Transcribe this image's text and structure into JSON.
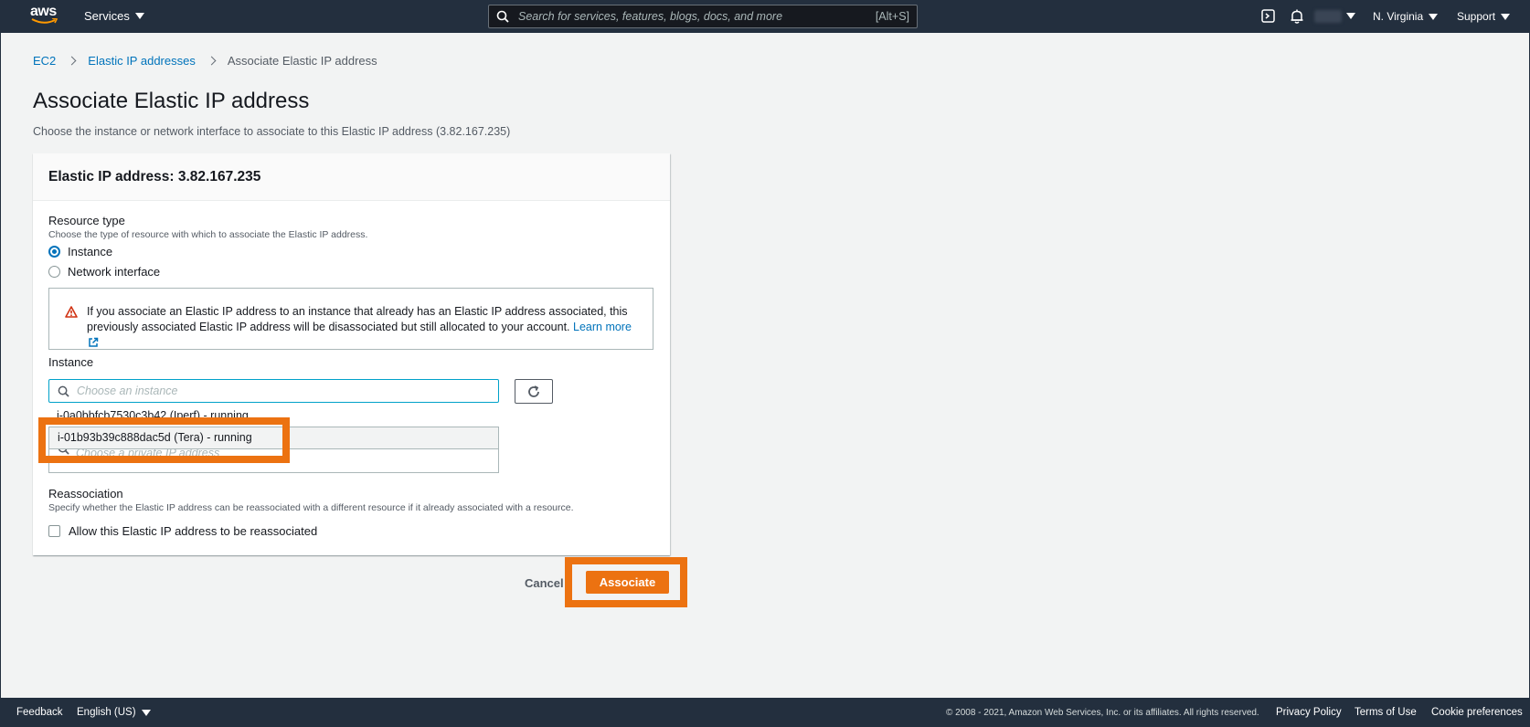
{
  "nav": {
    "logo": "aws",
    "services_label": "Services",
    "search_placeholder": "Search for services, features, blogs, docs, and more",
    "search_shortcut": "[Alt+S]",
    "region": "N. Virginia",
    "support": "Support",
    "icons": [
      "cloudshell-icon",
      "bell-icon"
    ]
  },
  "breadcrumb": {
    "items": [
      "EC2",
      "Elastic IP addresses"
    ],
    "current": "Associate Elastic IP address"
  },
  "page": {
    "title": "Associate Elastic IP address",
    "description": "Choose the instance or network interface to associate to this Elastic IP address (3.82.167.235)"
  },
  "panel": {
    "header": "Elastic IP address: 3.82.167.235",
    "resource_type": {
      "label": "Resource type",
      "description": "Choose the type of resource with which to associate the Elastic IP address.",
      "options": [
        "Instance",
        "Network interface"
      ],
      "selected": "Instance"
    },
    "alert": {
      "text": "If you associate an Elastic IP address to an instance that already has an Elastic IP address associated, this previously associated Elastic IP address will be disassociated but still allocated to your account.",
      "link": "Learn more"
    },
    "instance": {
      "label": "Instance",
      "placeholder": "Choose an instance",
      "options": [
        "i-0a0bbfcb7530c3b42 (Iperf) - running",
        "i-01b93b39c888dac5d (Tera) - running"
      ]
    },
    "private_ip": {
      "placeholder": "Choose a private IP address"
    },
    "reassociation": {
      "label": "Reassociation",
      "description": "Specify whether the Elastic IP address can be reassociated with a different resource if it already associated with a resource.",
      "checkbox_label": "Allow this Elastic IP address to be reassociated"
    }
  },
  "actions": {
    "cancel": "Cancel",
    "associate": "Associate"
  },
  "footer": {
    "feedback": "Feedback",
    "language": "English (US)",
    "copyright": "© 2008 - 2021, Amazon Web Services, Inc. or its affiliates. All rights reserved.",
    "links": [
      "Privacy Policy",
      "Terms of Use",
      "Cookie preferences"
    ]
  },
  "colors": {
    "nav_bg": "#232f3e",
    "accent": "#ec7211",
    "link": "#0073bb"
  }
}
